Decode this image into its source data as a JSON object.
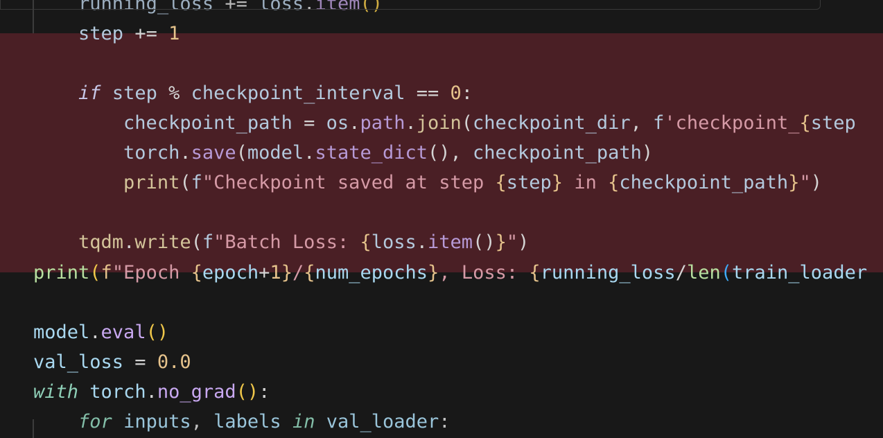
{
  "editor": {
    "lines": [
      {
        "id": "l0",
        "indent": "    ",
        "tokens": [
          {
            "c": "t-var",
            "t": "running_loss"
          },
          {
            "c": "t-op",
            "t": " += "
          },
          {
            "c": "t-var",
            "t": "loss"
          },
          {
            "c": "t-op",
            "t": "."
          },
          {
            "c": "t-method",
            "t": "item"
          },
          {
            "c": "t-paren",
            "t": "()"
          }
        ]
      },
      {
        "id": "l1",
        "indent": "    ",
        "tokens": [
          {
            "c": "t-var",
            "t": "step"
          },
          {
            "c": "t-op",
            "t": " += "
          },
          {
            "c": "t-num",
            "t": "1"
          }
        ]
      },
      {
        "id": "l2",
        "indent": "",
        "tokens": []
      },
      {
        "id": "l3",
        "indent": "    ",
        "tokens": [
          {
            "c": "t-kw-i",
            "t": "if"
          },
          {
            "c": "t-op",
            "t": " "
          },
          {
            "c": "t-var",
            "t": "step"
          },
          {
            "c": "t-op",
            "t": " % "
          },
          {
            "c": "t-var",
            "t": "checkpoint_interval"
          },
          {
            "c": "t-op",
            "t": " == "
          },
          {
            "c": "t-num",
            "t": "0"
          },
          {
            "c": "t-op",
            "t": ":"
          }
        ]
      },
      {
        "id": "l4",
        "indent": "        ",
        "tokens": [
          {
            "c": "t-var",
            "t": "checkpoint_path"
          },
          {
            "c": "t-op",
            "t": " = "
          },
          {
            "c": "t-var",
            "t": "os"
          },
          {
            "c": "t-op",
            "t": "."
          },
          {
            "c": "t-method",
            "t": "path"
          },
          {
            "c": "t-op",
            "t": "."
          },
          {
            "c": "t-fn2",
            "t": "join"
          },
          {
            "c": "t-op",
            "t": "("
          },
          {
            "c": "t-var",
            "t": "checkpoint_dir"
          },
          {
            "c": "t-op",
            "t": ", "
          },
          {
            "c": "t-var",
            "t": "f"
          },
          {
            "c": "t-str",
            "t": "'checkpoint_"
          },
          {
            "c": "t-brace",
            "t": "{"
          },
          {
            "c": "t-var",
            "t": "step"
          }
        ]
      },
      {
        "id": "l5",
        "indent": "        ",
        "tokens": [
          {
            "c": "t-var",
            "t": "torch"
          },
          {
            "c": "t-op",
            "t": "."
          },
          {
            "c": "t-method",
            "t": "save"
          },
          {
            "c": "t-op",
            "t": "("
          },
          {
            "c": "t-var",
            "t": "model"
          },
          {
            "c": "t-op",
            "t": "."
          },
          {
            "c": "t-method",
            "t": "state_dict"
          },
          {
            "c": "t-op",
            "t": "(), "
          },
          {
            "c": "t-var",
            "t": "checkpoint_path"
          },
          {
            "c": "t-op",
            "t": ")"
          }
        ]
      },
      {
        "id": "l6",
        "indent": "        ",
        "tokens": [
          {
            "c": "t-fn2",
            "t": "print"
          },
          {
            "c": "t-op",
            "t": "("
          },
          {
            "c": "t-var",
            "t": "f"
          },
          {
            "c": "t-str",
            "t": "\"Checkpoint saved at step "
          },
          {
            "c": "t-brace",
            "t": "{"
          },
          {
            "c": "t-var",
            "t": "step"
          },
          {
            "c": "t-brace",
            "t": "}"
          },
          {
            "c": "t-str",
            "t": " in "
          },
          {
            "c": "t-brace",
            "t": "{"
          },
          {
            "c": "t-var",
            "t": "checkpoint_path"
          },
          {
            "c": "t-brace",
            "t": "}"
          },
          {
            "c": "t-str",
            "t": "\""
          },
          {
            "c": "t-op",
            "t": ")"
          }
        ]
      },
      {
        "id": "l7",
        "indent": "",
        "tokens": []
      },
      {
        "id": "l8",
        "indent": "    ",
        "tokens": [
          {
            "c": "t-fn2",
            "t": "tqdm"
          },
          {
            "c": "t-op",
            "t": "."
          },
          {
            "c": "t-fn2",
            "t": "write"
          },
          {
            "c": "t-op",
            "t": "("
          },
          {
            "c": "t-var",
            "t": "f"
          },
          {
            "c": "t-str",
            "t": "\"Batch Loss: "
          },
          {
            "c": "t-brace",
            "t": "{"
          },
          {
            "c": "t-var",
            "t": "loss"
          },
          {
            "c": "t-op",
            "t": "."
          },
          {
            "c": "t-method",
            "t": "item"
          },
          {
            "c": "t-op",
            "t": "()"
          },
          {
            "c": "t-brace",
            "t": "}"
          },
          {
            "c": "t-str",
            "t": "\""
          },
          {
            "c": "t-op",
            "t": ")"
          }
        ]
      },
      {
        "id": "l9",
        "indent": "",
        "tokens": [
          {
            "c": "t-fn2",
            "t": "print"
          },
          {
            "c": "t-paren",
            "t": "("
          },
          {
            "c": "t-kw",
            "t": "f"
          },
          {
            "c": "t-str",
            "t": "\"Epoch "
          },
          {
            "c": "t-brace",
            "t": "{"
          },
          {
            "c": "t-var",
            "t": "epoch"
          },
          {
            "c": "t-op",
            "t": "+"
          },
          {
            "c": "t-num",
            "t": "1"
          },
          {
            "c": "t-brace",
            "t": "}"
          },
          {
            "c": "t-str",
            "t": "/"
          },
          {
            "c": "t-brace",
            "t": "{"
          },
          {
            "c": "t-var",
            "t": "num_epochs"
          },
          {
            "c": "t-brace",
            "t": "}"
          },
          {
            "c": "t-str",
            "t": ", Loss: "
          },
          {
            "c": "t-brace",
            "t": "{"
          },
          {
            "c": "t-var",
            "t": "running_loss"
          },
          {
            "c": "t-op",
            "t": "/"
          },
          {
            "c": "t-fn2",
            "t": "len"
          },
          {
            "c": "t-paren2",
            "t": "("
          },
          {
            "c": "t-var",
            "t": "train_loader"
          }
        ]
      },
      {
        "id": "l10",
        "indent": "",
        "tokens": []
      },
      {
        "id": "l11",
        "indent": "",
        "tokens": [
          {
            "c": "t-var",
            "t": "model"
          },
          {
            "c": "t-op",
            "t": "."
          },
          {
            "c": "t-method",
            "t": "eval"
          },
          {
            "c": "t-paren",
            "t": "()"
          }
        ]
      },
      {
        "id": "l12",
        "indent": "",
        "tokens": [
          {
            "c": "t-var",
            "t": "val_loss"
          },
          {
            "c": "t-op",
            "t": " = "
          },
          {
            "c": "t-num",
            "t": "0.0"
          }
        ]
      },
      {
        "id": "l13",
        "indent": "",
        "tokens": [
          {
            "c": "t-kw-i",
            "t": "with"
          },
          {
            "c": "t-op",
            "t": " "
          },
          {
            "c": "t-var",
            "t": "torch"
          },
          {
            "c": "t-op",
            "t": "."
          },
          {
            "c": "t-method",
            "t": "no_grad"
          },
          {
            "c": "t-paren",
            "t": "()"
          },
          {
            "c": "t-op",
            "t": ":"
          }
        ]
      },
      {
        "id": "l14",
        "indent": "    ",
        "tokens": [
          {
            "c": "t-kw-i",
            "t": "for"
          },
          {
            "c": "t-op",
            "t": " "
          },
          {
            "c": "t-var",
            "t": "inputs"
          },
          {
            "c": "t-op",
            "t": ", "
          },
          {
            "c": "t-var",
            "t": "labels"
          },
          {
            "c": "t-op",
            "t": " "
          },
          {
            "c": "t-kw-i",
            "t": "in"
          },
          {
            "c": "t-op",
            "t": " "
          },
          {
            "c": "t-var",
            "t": "val_loader"
          },
          {
            "c": "t-op",
            "t": ":"
          }
        ]
      }
    ]
  },
  "colors": {
    "background": "#181818",
    "removed_band": "#4a1f25"
  }
}
